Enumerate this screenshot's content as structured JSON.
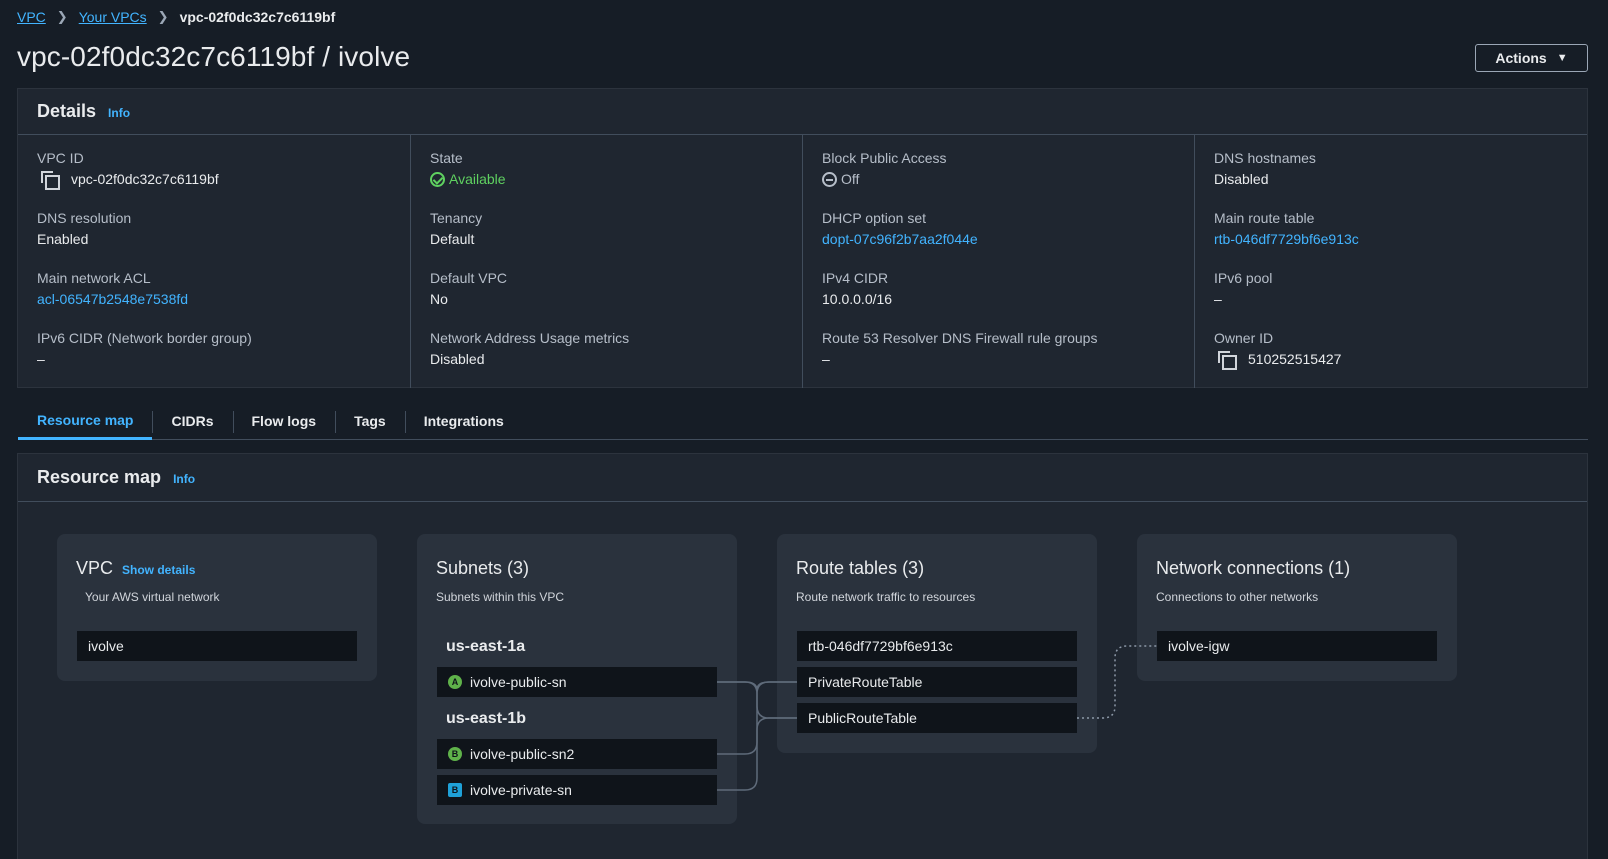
{
  "breadcrumb": {
    "items": [
      "VPC",
      "Your VPCs"
    ],
    "current": "vpc-02f0dc32c7c6119bf"
  },
  "page": {
    "title": "vpc-02f0dc32c7c6119bf / ivolve",
    "actions_label": "Actions"
  },
  "details": {
    "title": "Details",
    "info": "Info",
    "columns": [
      [
        {
          "label": "VPC ID",
          "value": "vpc-02f0dc32c7c6119bf"
        },
        {
          "label": "DNS resolution",
          "value": "Enabled"
        },
        {
          "label": "Main network ACL",
          "value": "acl-06547b2548e7538fd"
        },
        {
          "label": "IPv6 CIDR (Network border group)",
          "value": "–"
        }
      ],
      [
        {
          "label": "State",
          "value": "Available"
        },
        {
          "label": "Tenancy",
          "value": "Default"
        },
        {
          "label": "Default VPC",
          "value": "No"
        },
        {
          "label": "Network Address Usage metrics",
          "value": "Disabled"
        }
      ],
      [
        {
          "label": "Block Public Access",
          "value": "Off"
        },
        {
          "label": "DHCP option set",
          "value": "dopt-07c96f2b7aa2f044e"
        },
        {
          "label": "IPv4 CIDR",
          "value": "10.0.0.0/16"
        },
        {
          "label": "Route 53 Resolver DNS Firewall rule groups",
          "value": "–"
        }
      ],
      [
        {
          "label": "DNS hostnames",
          "value": "Disabled"
        },
        {
          "label": "Main route table",
          "value": "rtb-046df7729bf6e913c"
        },
        {
          "label": "IPv6 pool",
          "value": "–"
        },
        {
          "label": "Owner ID",
          "value": "510252515427"
        }
      ]
    ]
  },
  "tabs": [
    "Resource map",
    "CIDRs",
    "Flow logs",
    "Tags",
    "Integrations"
  ],
  "resource_map": {
    "title": "Resource map",
    "info": "Info",
    "vpc": {
      "title": "VPC",
      "show_details": "Show details",
      "subtitle": "Your AWS virtual network",
      "name": "ivolve"
    },
    "subnets": {
      "title": "Subnets (3)",
      "subtitle": "Subnets within this VPC",
      "zones": [
        {
          "name": "us-east-1a",
          "items": [
            {
              "badge": "A",
              "name": "ivolve-public-sn"
            }
          ]
        },
        {
          "name": "us-east-1b",
          "items": [
            {
              "badge": "B",
              "name": "ivolve-public-sn2"
            },
            {
              "badge": "B",
              "name": "ivolve-private-sn"
            }
          ]
        }
      ]
    },
    "route_tables": {
      "title": "Route tables (3)",
      "subtitle": "Route network traffic to resources",
      "items": [
        "rtb-046df7729bf6e913c",
        "PrivateRouteTable",
        "PublicRouteTable"
      ]
    },
    "network_connections": {
      "title": "Network connections (1)",
      "subtitle": "Connections to other networks",
      "items": [
        "ivolve-igw"
      ]
    }
  },
  "colors": {
    "background": "#161d26",
    "panel": "#1f2630",
    "link": "#42b4ff",
    "available": "#5fd160"
  }
}
